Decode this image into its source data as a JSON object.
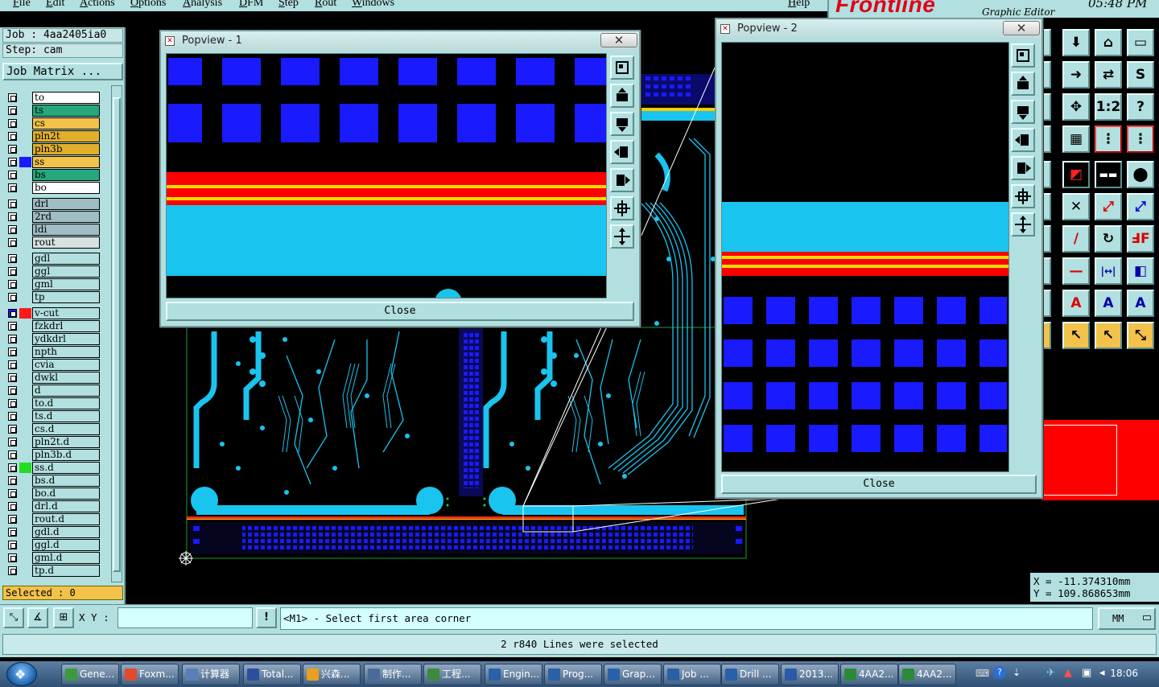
{
  "menu": [
    "File",
    "Edit",
    "Actions",
    "Options",
    "Analysis",
    "DFM",
    "Step",
    "Rout",
    "Windows",
    "Help"
  ],
  "brand": {
    "logo": "Frontline",
    "subtitle": "Graphic Editor",
    "clock": "05:48 PM"
  },
  "job": {
    "job_label": "Job : 4aa2405ia0",
    "step_label": "Step: cam",
    "matrix_button": "Job Matrix ..."
  },
  "layers": [
    {
      "name": "to",
      "color": "#ffffff"
    },
    {
      "name": "ts",
      "color": "#26a77c"
    },
    {
      "name": "cs",
      "color": "#f2c24a"
    },
    {
      "name": "pln2t",
      "color": "#e0b02a"
    },
    {
      "name": "pln3b",
      "color": "#e0b02a"
    },
    {
      "name": "ss",
      "color": "#f2c24a",
      "swatch": "#1a1aff"
    },
    {
      "name": "bs",
      "color": "#26a77c"
    },
    {
      "name": "bo",
      "color": "#ffffff"
    },
    {
      "name": "drl",
      "color": "#a0bcc4"
    },
    {
      "name": "2rd",
      "color": "#a0bcc4"
    },
    {
      "name": "ldi",
      "color": "#a0bcc4"
    },
    {
      "name": "rout",
      "color": "#d8e0e0"
    },
    {
      "name": "gdl",
      "color": "#b2dfdf"
    },
    {
      "name": "ggl",
      "color": "#b2dfdf"
    },
    {
      "name": "gml",
      "color": "#b2dfdf"
    },
    {
      "name": "tp",
      "color": "#b2dfdf"
    },
    {
      "name": "v-cut",
      "color": "#b2dfdf",
      "swatch": "#ff1a1a",
      "active": true
    },
    {
      "name": "fzkdrl",
      "color": "#b2dfdf"
    },
    {
      "name": "ydkdrl",
      "color": "#b2dfdf"
    },
    {
      "name": "npth",
      "color": "#b2dfdf"
    },
    {
      "name": "cvia",
      "color": "#b2dfdf"
    },
    {
      "name": "dwkl",
      "color": "#b2dfdf"
    },
    {
      "name": "d",
      "color": "#b2dfdf"
    },
    {
      "name": "to.d",
      "color": "#b2dfdf"
    },
    {
      "name": "ts.d",
      "color": "#b2dfdf"
    },
    {
      "name": "cs.d",
      "color": "#b2dfdf"
    },
    {
      "name": "pln2t.d",
      "color": "#b2dfdf"
    },
    {
      "name": "pln3b.d",
      "color": "#b2dfdf"
    },
    {
      "name": "ss.d",
      "color": "#b2dfdf",
      "swatch": "#22dd22"
    },
    {
      "name": "bs.d",
      "color": "#b2dfdf"
    },
    {
      "name": "bo.d",
      "color": "#b2dfdf"
    },
    {
      "name": "drl.d",
      "color": "#b2dfdf"
    },
    {
      "name": "rout.d",
      "color": "#b2dfdf"
    },
    {
      "name": "gdl.d",
      "color": "#b2dfdf"
    },
    {
      "name": "ggl.d",
      "color": "#b2dfdf"
    },
    {
      "name": "gml.d",
      "color": "#b2dfdf"
    },
    {
      "name": "tp.d",
      "color": "#b2dfdf"
    }
  ],
  "selected_label": "Selected : 0",
  "popview1": {
    "title": "Popview - 1",
    "close_label": "Close"
  },
  "popview2": {
    "title": "Popview - 2",
    "close_label": "Close"
  },
  "coords": {
    "x": "X = -11.374310mm",
    "y": "Y = 109.868653mm"
  },
  "command": {
    "xy_label": "X Y :",
    "xy_value": "",
    "prompt": "<M1> - Select first area corner",
    "units": "MM"
  },
  "status_message": "2 r840 Lines were selected",
  "taskbar": {
    "items": [
      "Gene...",
      "Foxm...",
      "计算器",
      "Total...",
      "兴森...",
      "制作...",
      "工程...",
      "Engin...",
      "Prog...",
      "Grap...",
      "Job ...",
      "Drill ...",
      "2013...",
      "4AA2...",
      "4AA2..."
    ],
    "time": "18:06"
  }
}
